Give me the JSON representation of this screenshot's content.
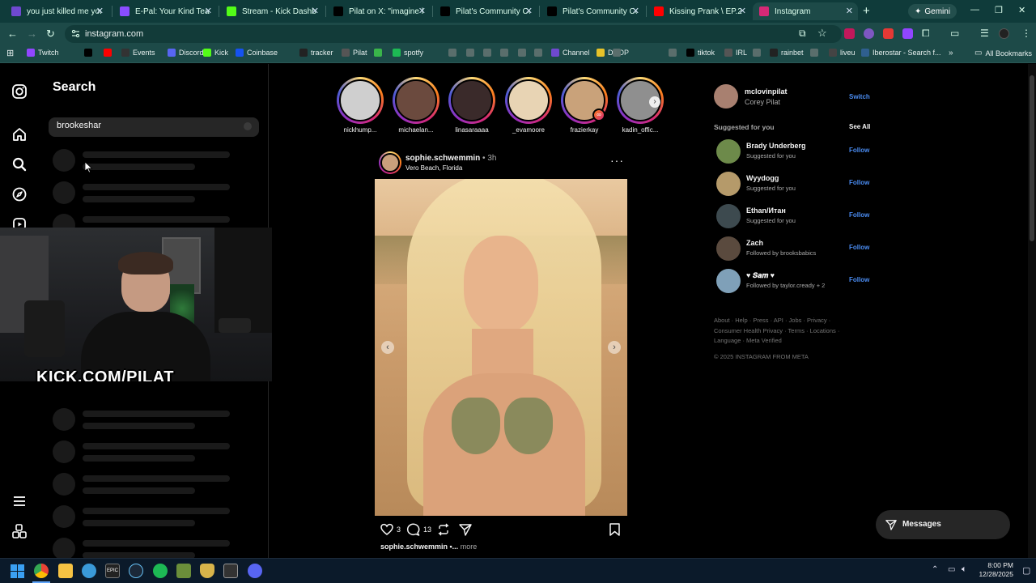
{
  "browser": {
    "tabs": [
      {
        "title": "you just killed me you",
        "color": "#6f49d0",
        "active": false
      },
      {
        "title": "E-Pal: Your Kind Teamm",
        "color": "#8a4dff",
        "active": false
      },
      {
        "title": "Stream - Kick Dashb",
        "color": "#53fc18",
        "active": false
      },
      {
        "title": "Pilat on X: \"imagine hav",
        "color": "#000000",
        "active": false
      },
      {
        "title": "Pilat's Community Com",
        "color": "#000000",
        "active": false
      },
      {
        "title": "Pilat's Community Com",
        "color": "#000000",
        "active": false
      },
      {
        "title": "Kissing Prank \\ EP.2 - Yo",
        "color": "#ff0000",
        "active": false
      },
      {
        "title": "Instagram",
        "color": "#d62976",
        "active": true
      }
    ],
    "new_tab_label": "+",
    "gemini_label": "Gemini",
    "url": "instagram.com",
    "bookmarks": [
      {
        "label": "Twitch",
        "color": "#9146ff"
      },
      {
        "label": "",
        "color": "#000000"
      },
      {
        "label": "",
        "color": "#ff0000"
      },
      {
        "label": "Events",
        "color": "#333333"
      },
      {
        "label": "Discord",
        "color": "#5865f2"
      },
      {
        "label": "Kick",
        "color": "#53fc18"
      },
      {
        "label": "Coinbase",
        "color": "#1652f0"
      },
      {
        "label": "tracker",
        "color": "#222222"
      },
      {
        "label": "Pilat",
        "color": "#555555"
      },
      {
        "label": "",
        "color": "#3ab54a"
      },
      {
        "label": "spotfy",
        "color": "#1db954"
      },
      {
        "label": "Channel",
        "color": "#6f49d0"
      },
      {
        "label": "DROP",
        "color": "#e6c229"
      },
      {
        "label": "tiktok",
        "color": "#000000"
      },
      {
        "label": "IRL",
        "color": "#555555"
      },
      {
        "label": "rainbet",
        "color": "#222222"
      },
      {
        "label": "liveu",
        "color": "#444444"
      },
      {
        "label": "Iberostar - Search f...",
        "color": "#2f5f8f"
      }
    ],
    "all_bookmarks_label": "All Bookmarks"
  },
  "search_panel": {
    "title": "Search",
    "query": "brookeshar"
  },
  "webcam": {
    "overlay_text": "KICK.COM/PILAT"
  },
  "stories": [
    {
      "name": "nickhump...",
      "color": "#cfcfcf"
    },
    {
      "name": "michaelan...",
      "color": "#6b4a3e"
    },
    {
      "name": "linasaraaaa",
      "color": "#3a2a2a"
    },
    {
      "name": "_evamoore",
      "color": "#e8d4b4"
    },
    {
      "name": "frazierkay",
      "color": "#c9a27a"
    },
    {
      "name": "kadin_offic...",
      "color": "#8f8f8f"
    }
  ],
  "post": {
    "username": "sophie.schwemmin",
    "time": "3h",
    "location": "Vero Beach, Florida",
    "likes": "3",
    "comments": "13",
    "caption_user": "sophie.schwemmin",
    "caption_rest": " •...",
    "more_label": "more"
  },
  "profile": {
    "username": "mclovinpilat",
    "name": "Corey Pilat",
    "switch_label": "Switch"
  },
  "suggested": {
    "heading": "Suggested for you",
    "see_all": "See All",
    "follow_label": "Follow",
    "users": [
      {
        "username": "Brady Underberg",
        "subtitle": "Suggested for you",
        "color": "#6d8a4a"
      },
      {
        "username": "Wyydogg",
        "subtitle": "Suggested for you",
        "color": "#b59a6a"
      },
      {
        "username": "Ethan/Итан",
        "subtitle": "Suggested for you",
        "color": "#3d4a4f"
      },
      {
        "username": "Zach",
        "subtitle": "Followed by brooksbabics",
        "color": "#5a4a3e"
      },
      {
        "username": "♥ 𝑺𝒂𝒎 ♥",
        "subtitle": "Followed by taylor.cready + 2",
        "color": "#7fa0b8"
      }
    ]
  },
  "footer": {
    "line1": "About · Help · Press · API · Jobs · Privacy ·",
    "line2": "Consumer Health Privacy · Terms · Locations ·",
    "line3": "Language · Meta Verified",
    "copyright": "© 2025 INSTAGRAM FROM META"
  },
  "messages_label": "Messages",
  "taskbar": {
    "time": "8:00 PM",
    "date": "12/28/2025"
  }
}
